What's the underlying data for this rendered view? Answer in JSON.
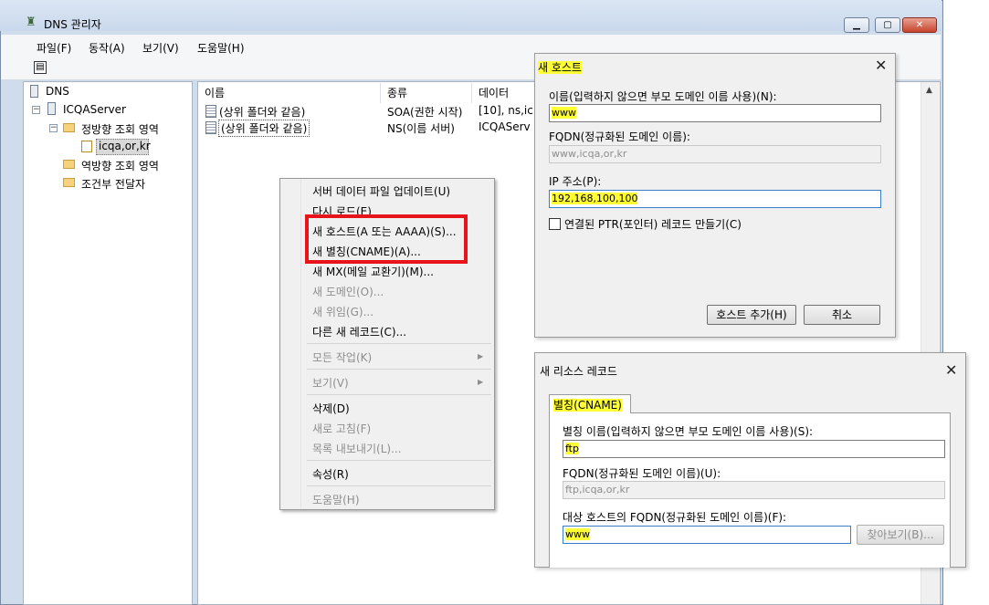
{
  "window": {
    "title": "DNS 관리자",
    "minimize_glyph": "▁",
    "maximize_glyph": "▢",
    "close_glyph": "✕"
  },
  "menu": [
    "파일(F)",
    "동작(A)",
    "보기(V)",
    "도움말(H)"
  ],
  "tree": {
    "root": "DNS",
    "server": "ICQAServer",
    "forward_zone": "정방향 조회 영역",
    "zone": "icqa,or,kr",
    "reverse_zone": "역방향 조회 영역",
    "conditional_forwarders": "조건부 전달자",
    "expanded_glyph": "−"
  },
  "list": {
    "columns": [
      "이름",
      "종류",
      "데이터"
    ],
    "rows": [
      {
        "name": "(상위 폴더와 같음)",
        "type": "SOA(권한 시작)",
        "data": "[10], ns,ic"
      },
      {
        "name": "(상위 폴더와 같음)",
        "type": "NS(이름 서버)",
        "data": "ICQAServ"
      }
    ]
  },
  "context_menu": {
    "items": [
      {
        "label": "서버 데이터 파일 업데이트(U)",
        "disabled": false
      },
      {
        "label": "다시 로드(E)",
        "disabled": false
      },
      {
        "label": "새 호스트(A 또는 AAAA)(S)...",
        "disabled": false
      },
      {
        "label": "새 별칭(CNAME)(A)...",
        "disabled": false
      },
      {
        "label": "새 MX(메일 교환기)(M)...",
        "disabled": false
      },
      {
        "label": "새 도메인(O)...",
        "disabled": true
      },
      {
        "label": "새 위임(G)...",
        "disabled": true
      },
      {
        "label": "다른 새 레코드(C)...",
        "disabled": false
      },
      {
        "label": "모든 작업(K)",
        "disabled": true
      },
      {
        "label": "보기(V)",
        "disabled": true
      },
      {
        "label": "삭제(D)",
        "disabled": false
      },
      {
        "label": "새로 고침(F)",
        "disabled": true
      },
      {
        "label": "목록 내보내기(L)...",
        "disabled": true
      },
      {
        "label": "속성(R)",
        "disabled": false
      },
      {
        "label": "도움말(H)",
        "disabled": true
      }
    ],
    "submenu_arrow": "▶",
    "highlight_color": "#e8141c"
  },
  "new_host_dialog": {
    "title": "새 호스트",
    "close_glyph": "✕",
    "name_label": "이름(입력하지 않으면 부모 도메인 이름 사용)(N):",
    "name_value": "www",
    "fqdn_label": "FQDN(정규화된 도메인 이름):",
    "fqdn_value": "www,icqa,or,kr",
    "ip_label": "IP 주소(P):",
    "ip_value": "192,168,100,100",
    "ptr_checkbox_label": "연결된 PTR(포인터) 레코드 만들기(C)",
    "ptr_checked": false,
    "add_host_button": "호스트 추가(H)",
    "cancel_button": "취소"
  },
  "resource_record_dialog": {
    "title": "새 리소스 레코드",
    "close_glyph": "✕",
    "tab_label": "별칭(CNAME)",
    "alias_label": "별칭 이름(입력하지 않으면 부모 도메인 이름 사용)(S):",
    "alias_value": "ftp",
    "fqdn_label": "FQDN(정규화된 도메인 이름)(U):",
    "fqdn_value": "ftp,icqa,or,kr",
    "target_label": "대상 호스트의 FQDN(정규화된 도메인 이름)(F):",
    "target_value": "www",
    "browse_button": "찾아보기(B)..."
  },
  "colors": {
    "highlight": "#ffff33",
    "window_frame": "#cfdcec"
  }
}
